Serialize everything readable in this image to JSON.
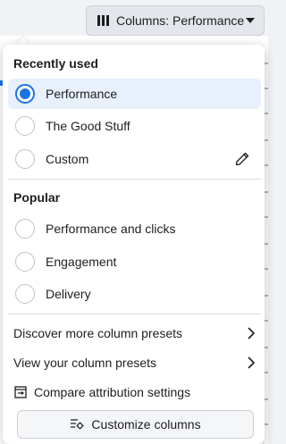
{
  "toolbar": {
    "columns_button_label": "Columns: Performance",
    "columns_icon": "columns-icon",
    "caret_icon": "caret-down-icon"
  },
  "menu": {
    "recently_used": {
      "title": "Recently used",
      "options": [
        {
          "label": "Performance",
          "selected": true
        },
        {
          "label": "The Good Stuff",
          "selected": false
        },
        {
          "label": "Custom",
          "selected": false,
          "icon": "pencil-icon"
        }
      ]
    },
    "popular": {
      "title": "Popular",
      "options": [
        {
          "label": "Performance and clicks",
          "selected": false
        },
        {
          "label": "Engagement",
          "selected": false
        },
        {
          "label": "Delivery",
          "selected": false
        }
      ]
    },
    "links": [
      {
        "label": "Discover more column presets",
        "icon": "chevron-right-icon"
      },
      {
        "label": "View your column presets",
        "icon": "chevron-right-icon"
      },
      {
        "label": "Compare attribution settings",
        "icon": "compare-attribution-icon"
      }
    ],
    "customize_button_label": "Customize columns",
    "customize_icon": "customize-columns-icon"
  },
  "colors": {
    "accent": "#1b74e4",
    "selected_bg": "#e7f0fb",
    "button_bg": "#e4e6eb",
    "text": "#1c1e21"
  }
}
